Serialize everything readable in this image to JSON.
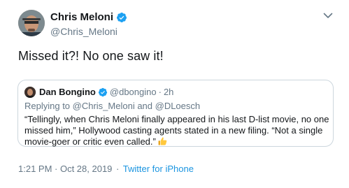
{
  "tweet": {
    "author_name": "Chris Meloni",
    "author_handle": "@Chris_Meloni",
    "text": "Missed it?! No one saw it!",
    "timestamp": "1:21 PM · Oct 28, 2019",
    "separator": "·",
    "source": "Twitter for iPhone"
  },
  "quoted": {
    "author_name": "Dan Bongino",
    "author_handle": "@dbongino",
    "dot": "·",
    "time": "2h",
    "reply_to": "Replying to @Chris_Meloni and @DLoesch",
    "body": "“Tellingly, when Chris Meloni finally appeared in his last D-list movie, no one missed him,” Hollywood casting agents stated in a new filing. “Not a single movie-goer or critic even called.”"
  },
  "icons": {
    "verified": "verified-badge-icon",
    "menu": "chevron-down-icon",
    "emoji": "thumbs-up-emoji"
  },
  "colors": {
    "verified": "#1da1f2",
    "link": "#1b95e0",
    "muted": "#657786",
    "border": "#ccd6dd"
  }
}
